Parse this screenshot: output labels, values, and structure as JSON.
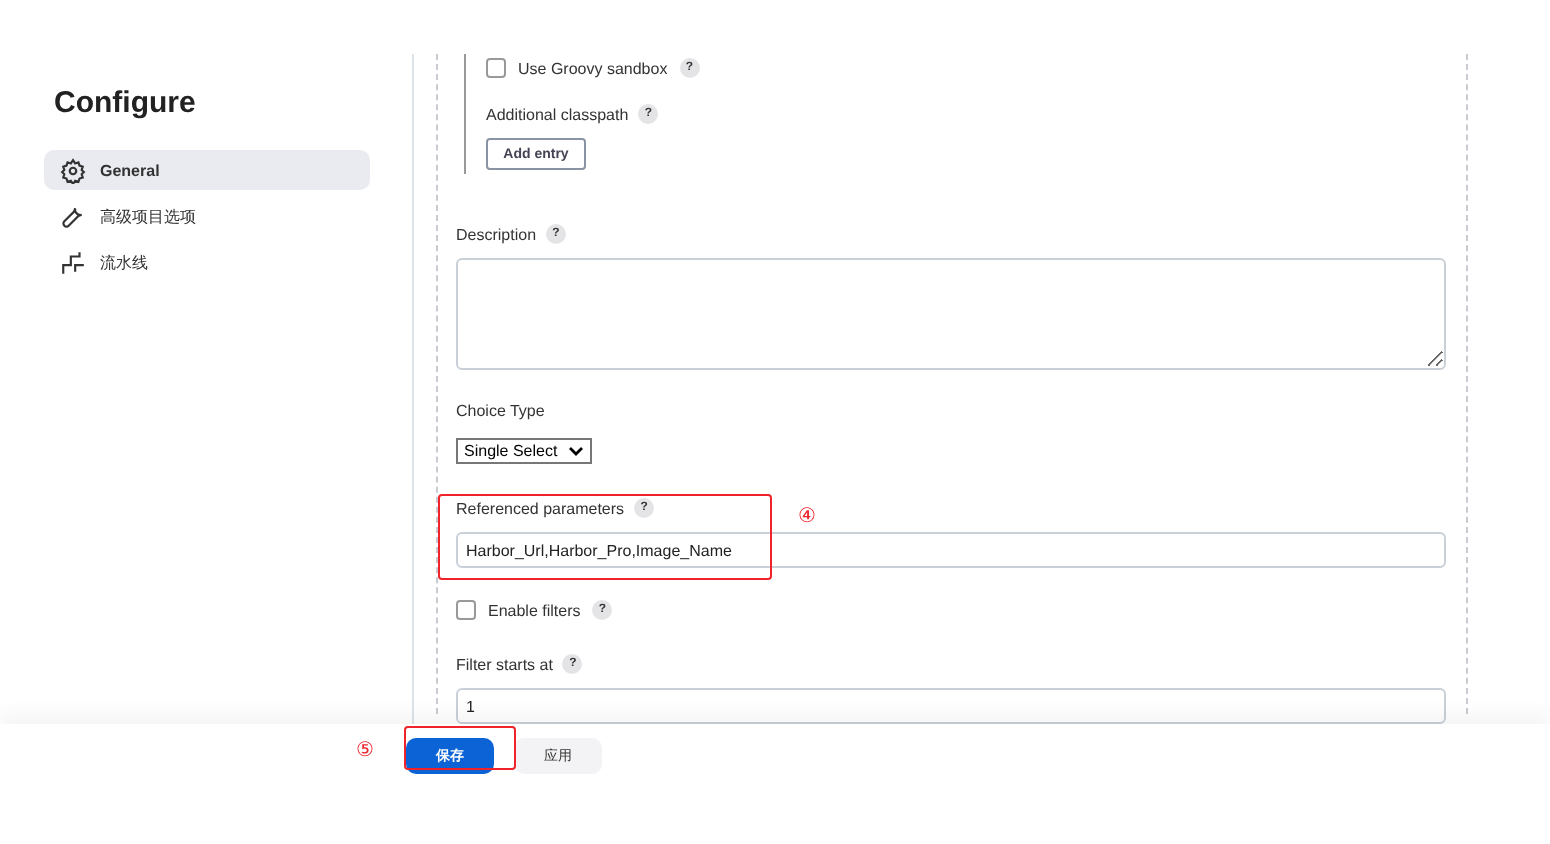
{
  "sidebar": {
    "title": "Configure",
    "items": [
      {
        "label": "General",
        "selected": true
      },
      {
        "label": "高级项目选项",
        "selected": false
      },
      {
        "label": "流水线",
        "selected": false
      }
    ]
  },
  "form": {
    "sandbox": {
      "label": "Use Groovy sandbox",
      "checked": false
    },
    "classpath": {
      "label": "Additional classpath",
      "button": "Add entry"
    },
    "description": {
      "label": "Description"
    },
    "choice_type": {
      "label": "Choice Type",
      "value": "Single Select"
    },
    "referenced": {
      "label": "Referenced parameters",
      "value": "Harbor_Url,Harbor_Pro,Image_Name"
    },
    "filters": {
      "label": "Enable filters",
      "checked": false
    },
    "filter_start": {
      "label": "Filter starts at",
      "value": "1"
    }
  },
  "help_mark": "?",
  "buttons": [
    {
      "label": "保存",
      "kind": "primary"
    },
    {
      "label": "应用",
      "kind": "secondary"
    }
  ],
  "annotations": [
    {
      "label": "④"
    },
    {
      "label": "⑤"
    }
  ]
}
